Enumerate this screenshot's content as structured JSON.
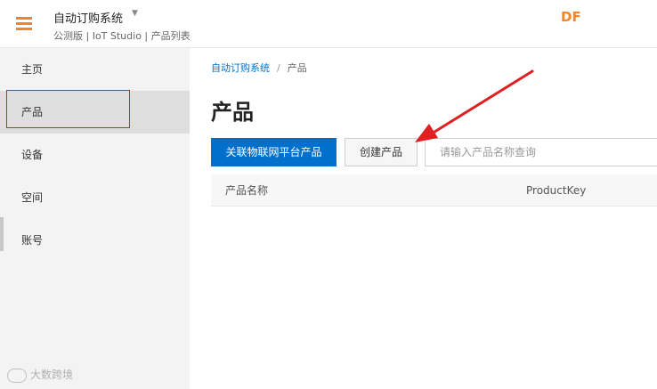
{
  "header": {
    "app_title": "自动订购系统",
    "title_caret": "▼",
    "subtitle": "公测版 | IoT Studio | 产品列表",
    "brand": "DF"
  },
  "sidebar": {
    "items": [
      {
        "label": "主页"
      },
      {
        "label": "产品"
      },
      {
        "label": "设备"
      },
      {
        "label": "空间"
      },
      {
        "label": "账号"
      }
    ]
  },
  "watermark": "大数跨境",
  "breadcrumb": {
    "root": "自动订购系统",
    "separator": "/",
    "current": "产品"
  },
  "page_title": "产品",
  "toolbar": {
    "link_platform_label": "关联物联网平台产品",
    "create_product_label": "创建产品",
    "search_placeholder": "请输入产品名称查询",
    "search_value": ""
  },
  "table": {
    "columns": [
      "产品名称",
      "ProductKey"
    ]
  },
  "colors": {
    "accent": "#f5832a",
    "primary": "#0070cc",
    "annotation": "#e02020"
  }
}
